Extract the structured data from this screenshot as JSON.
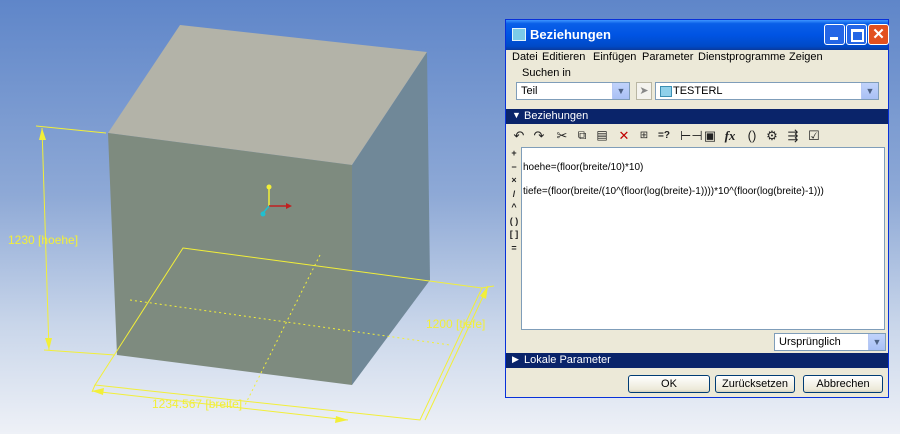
{
  "viewport": {
    "dimensions": [
      {
        "name": "hoehe",
        "label": "1230 [hoehe]"
      },
      {
        "name": "tiefe",
        "label": "1200 [tiefe]"
      },
      {
        "name": "breite",
        "label": "1234.567 [breite]"
      }
    ],
    "colors": {
      "cube_front": "#7e8b7f",
      "cube_top": "#b3b3a8",
      "cube_side": "#708898",
      "dimension": "#f2ef38"
    }
  },
  "dialog": {
    "title": "Beziehungen",
    "menu": [
      "Datei",
      "Editieren",
      "Einfügen",
      "Parameter",
      "Dienstprogramme",
      "Zeigen",
      "Suchen in"
    ],
    "type_select": {
      "value": "Teil"
    },
    "model_select": {
      "value": "TESTERL"
    },
    "section_relations": "Beziehungen",
    "toolbar_icons": [
      "undo-icon",
      "redo-icon",
      "cut-icon",
      "copy-icon",
      "paste-icon",
      "delete-icon",
      "evaluate-icon",
      "compare-icon",
      "measure-icon",
      "analysis-icon",
      "function-icon",
      "brackets-icon",
      "parameter-icon",
      "sort-icon",
      "verify-icon"
    ],
    "toolbar_glyphs": {
      "function": "fx",
      "brackets": "()",
      "compare": "=?"
    },
    "operators": [
      "+",
      "−",
      "×",
      "/",
      "^",
      "( )",
      "[ ]",
      "="
    ],
    "relations": [
      "hoehe=(floor(breite/10)*10)",
      "tiefe=(floor(breite/(10^(floor(log(breite)-1))))*10^(floor(log(breite)-1)))"
    ],
    "display_select": {
      "value": "Ursprünglich"
    },
    "section_local": "Lokale Parameter",
    "buttons": {
      "ok": "OK",
      "reset": "Zurücksetzen",
      "cancel": "Abbrechen"
    }
  }
}
